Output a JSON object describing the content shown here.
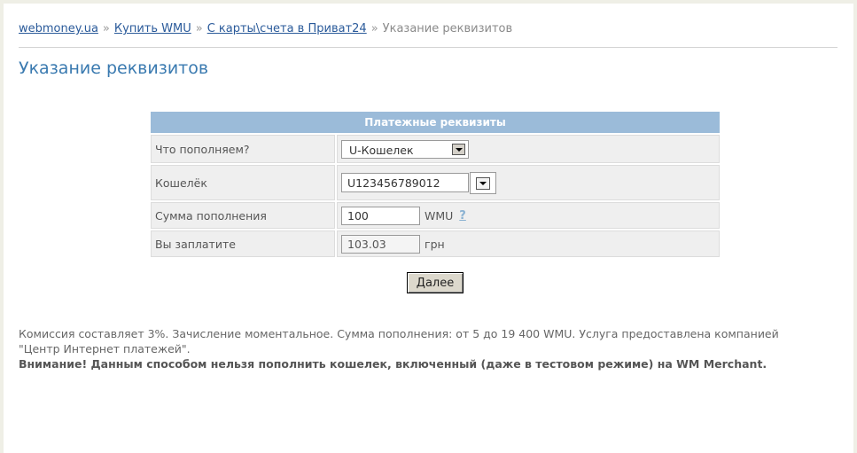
{
  "breadcrumb": {
    "items": [
      "webmoney.ua",
      "Купить WMU",
      "С карты\\счета в Приват24"
    ],
    "separator": "»",
    "current": "Указание реквизитов"
  },
  "page_title": "Указание реквизитов",
  "form": {
    "header": "Платежные реквизиты",
    "rows": {
      "what": {
        "label": "Что пополняем?",
        "selected": "U-Кошелек"
      },
      "wallet": {
        "label": "Кошелёк",
        "value": "U123456789012"
      },
      "amount": {
        "label": "Сумма пополнения",
        "value": "100",
        "unit": "WMU",
        "help": "?"
      },
      "pay": {
        "label": "Вы заплатите",
        "value": "103.03",
        "unit": "грн"
      }
    },
    "submit_label": "Далее"
  },
  "info": {
    "text": "Комиссия составляет 3%. Зачисление моментальное. Сумма пополнения: от 5 до 19 400 WMU. Услуга предоставлена компанией \"Центр Интернет платежей\".",
    "warning": "Внимание! Данным способом нельзя пополнить кошелек, включенный (даже в тестовом режиме) на WM Merchant."
  },
  "colors": {
    "link": "#2a5a9a",
    "title": "#3a7ab0",
    "table_header": "#9bbbd9",
    "row_bg": "#efefef"
  }
}
